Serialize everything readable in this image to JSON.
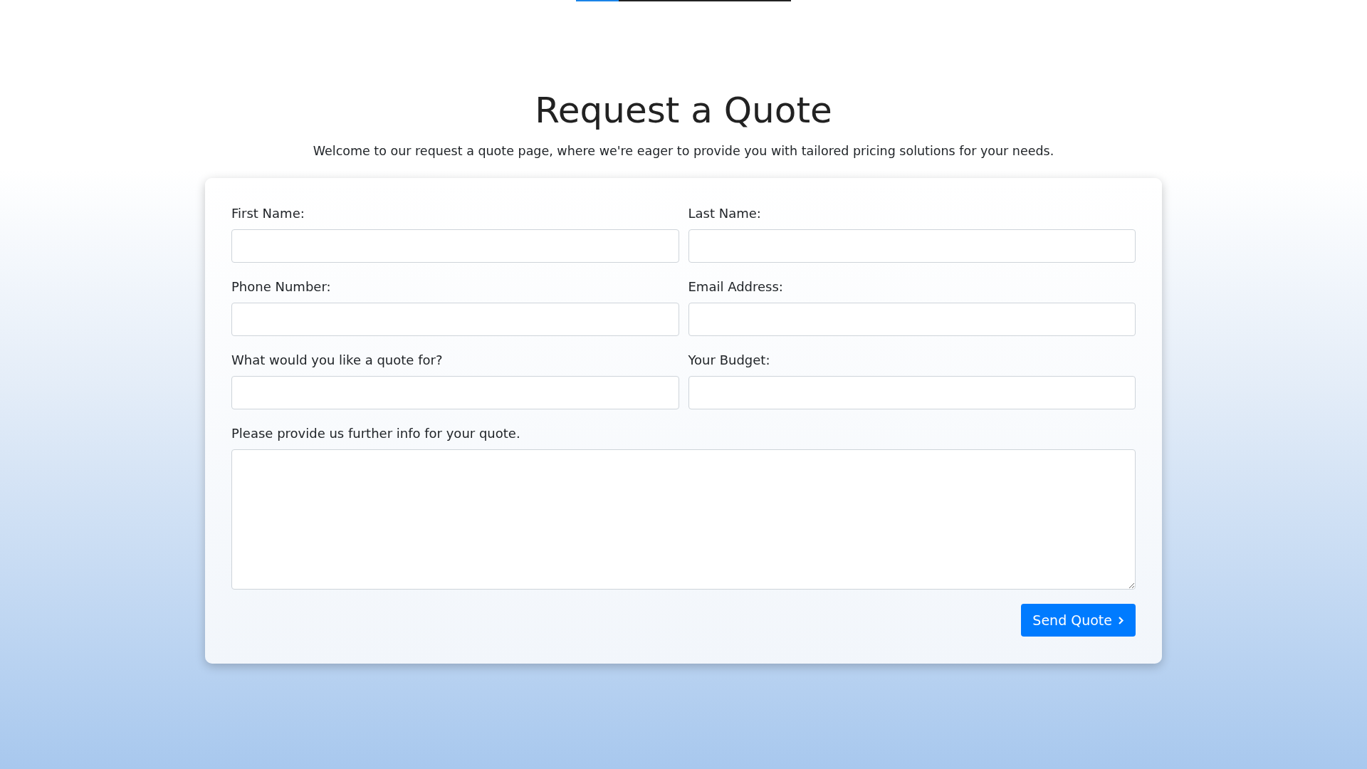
{
  "progress": {
    "level": 0.2
  },
  "title": "Request a Quote",
  "subtitle": "Welcome to our request a quote page, where we're eager to provide you with tailored pricing solutions for your needs.",
  "fields": [
    {
      "label": "First Name:",
      "kind": "input"
    },
    {
      "label": "Last Name:",
      "kind": "input"
    },
    {
      "label": "Phone Number:",
      "kind": "input"
    },
    {
      "label": "Email Address:",
      "kind": "input"
    },
    {
      "label": "What would you like a quote for?",
      "kind": "input"
    },
    {
      "label": "Your Budget:",
      "kind": "input"
    },
    {
      "label": "Please provide us further info for your quote.",
      "kind": "textarea"
    }
  ],
  "submit": {
    "label": "Send Quote"
  }
}
